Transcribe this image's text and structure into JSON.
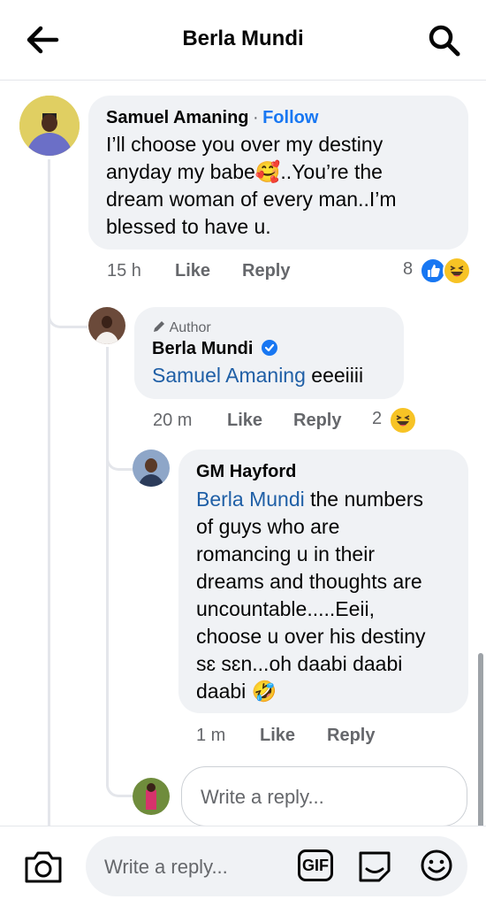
{
  "header": {
    "title": "Berla Mundi"
  },
  "comments": [
    {
      "author": "Samuel Amaning",
      "follow": "Follow",
      "separator": "·",
      "text": "I’ll choose you over my destiny anyday my babe🥰..You’re the dream woman of every man..I’m blessed to have u.",
      "line1": "I’ll choose you over my destiny",
      "line2a": "anyday my babe",
      "line2b": "..You’re the",
      "line3": "dream woman of every man..I’m",
      "line4": "blessed to have u.",
      "time": "15 h",
      "like": "Like",
      "reply": "Reply",
      "reactions_count": "8"
    },
    {
      "badge": "Author",
      "author": "Berla Mundi",
      "mention": "Samuel Amaning",
      "text": " eeeiiii",
      "time": "20 m",
      "like": "Like",
      "reply": "Reply",
      "reactions_count": "2"
    },
    {
      "author": "GM Hayford",
      "mention": "Berla Mundi",
      "line1b": " the numbers",
      "line2": "of guys who are",
      "line3": "romancing u in their",
      "line4": "dreams and thoughts are",
      "line5": "uncountable.....Eeii,",
      "line6": "choose u over his destiny",
      "line7": "sɛ sɛn...oh daabi daabi",
      "line8": "daabi",
      "time": "1 m",
      "like": "Like",
      "reply": "Reply"
    }
  ],
  "reply_input": {
    "placeholder": "Write a reply..."
  },
  "bottom_bar": {
    "placeholder": "Write a reply...",
    "gif_label": "GIF"
  },
  "colors": {
    "accent": "#1877f2",
    "bubble": "#f0f2f5",
    "meta": "#65676b",
    "line": "#e4e6eb"
  },
  "icons": [
    "back-arrow-icon",
    "search-icon",
    "verified-badge-icon",
    "pencil-icon",
    "like-reaction-icon",
    "haha-reaction-icon",
    "camera-icon",
    "gif-icon",
    "sticker-icon",
    "emoji-icon"
  ]
}
